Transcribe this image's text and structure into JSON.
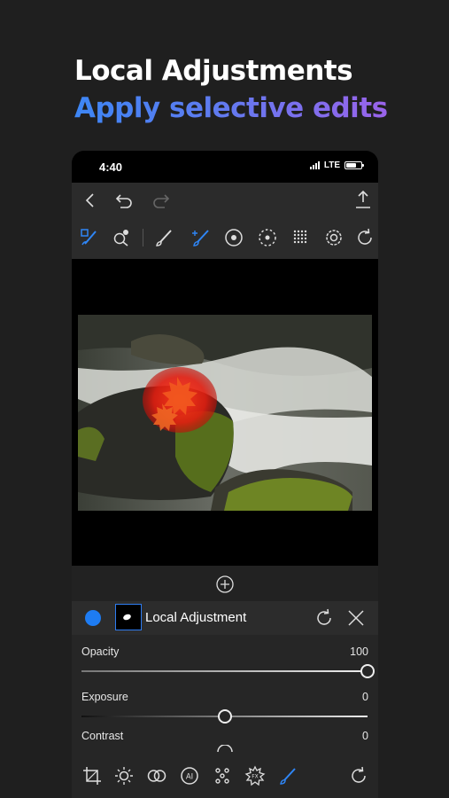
{
  "promo": {
    "headline": "Local Adjustments",
    "subhead": "Apply selective edits"
  },
  "status_bar": {
    "time": "4:40",
    "network": "LTE"
  },
  "top_bar": {
    "icons": [
      "back-icon",
      "undo-icon",
      "redo-icon",
      "share-icon"
    ]
  },
  "tool_row": {
    "icons": [
      "brush-mask-icon",
      "quick-select-icon",
      "brush-icon",
      "brush-add-icon",
      "radial-icon",
      "radial-dashed-icon",
      "gradient-icon",
      "settings-icon",
      "reset-icon"
    ],
    "active_color": "#2f86f6"
  },
  "layer": {
    "title": "Local Adjustment",
    "color": "#1e7cf2"
  },
  "adjustments": [
    {
      "label": "Opacity",
      "value": "100",
      "level": 1.0
    },
    {
      "label": "Exposure",
      "value": "0",
      "level": 0.5
    },
    {
      "label": "Contrast",
      "value": "0",
      "level": 0.5
    }
  ],
  "bottom_bar": {
    "icons": [
      "crop-icon",
      "light-icon",
      "color-icon",
      "ai-icon",
      "detail-icon",
      "fx-icon",
      "brush-icon",
      "history-icon"
    ],
    "active": "brush-icon"
  }
}
